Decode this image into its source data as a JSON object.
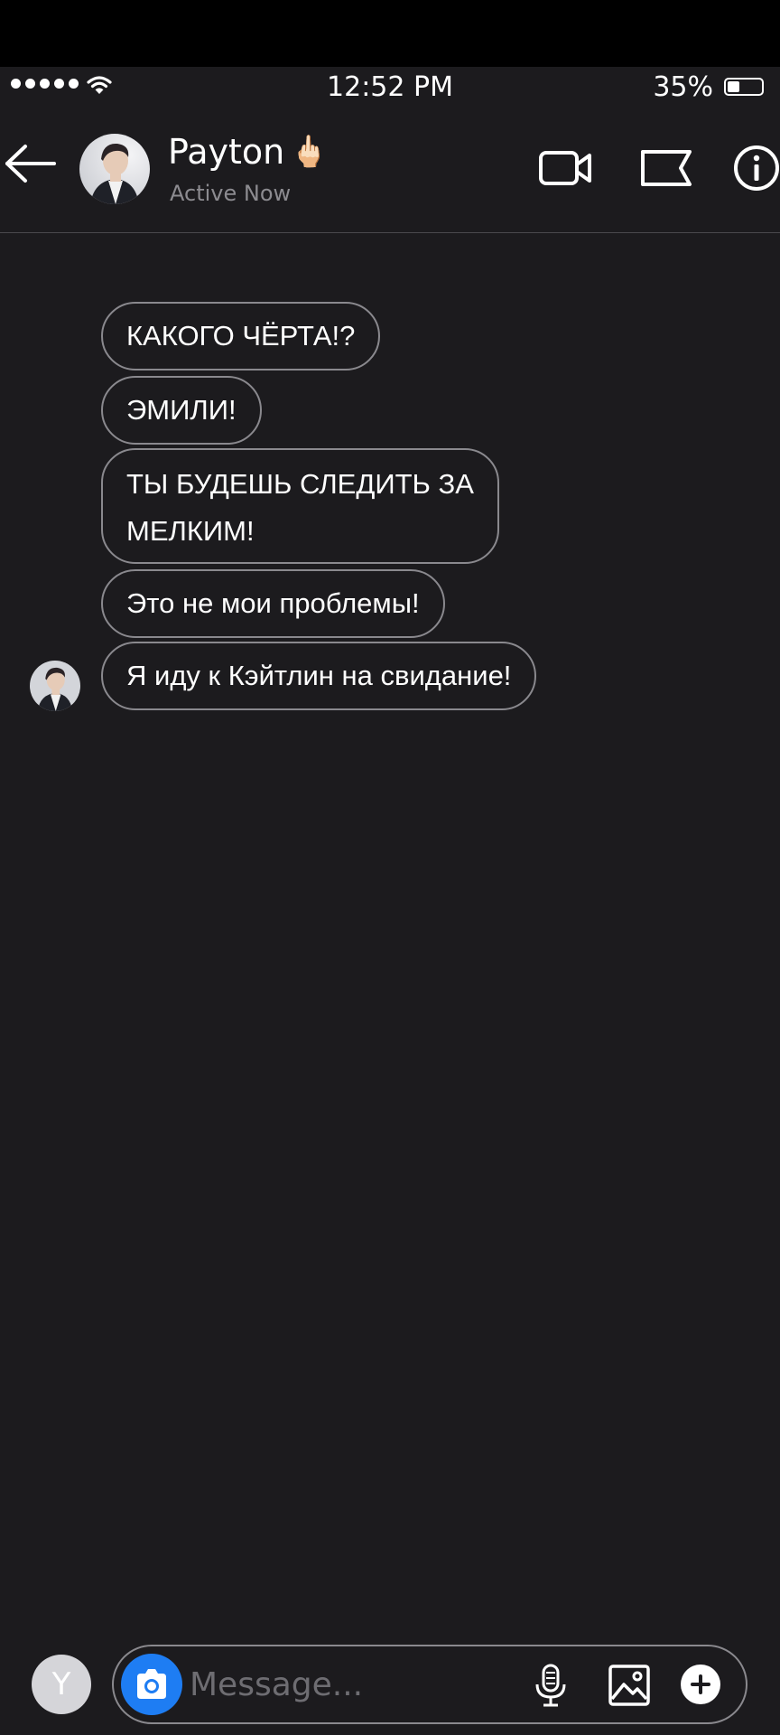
{
  "status_bar": {
    "time": "12:52 PM",
    "battery_text": "35%",
    "battery_level": 0.35
  },
  "header": {
    "contact_name": "Payton",
    "name_emoji": "🖕🏻",
    "status": "Active Now"
  },
  "messages": [
    "КАКОГО ЧЁРТА!?",
    "ЭМИЛИ!",
    "ТЫ БУДЕШЬ СЛЕДИТЬ ЗА\nМЕЛКИМ!",
    "Это не мои проблемы!",
    "Я иду к Кэйтлин на свидание!"
  ],
  "composer": {
    "avatar_initial": "Y",
    "placeholder": "Message..."
  },
  "colors": {
    "background": "#1c1b1e",
    "bubble_border": "#8a898e",
    "camera_button": "#1e7df3"
  },
  "icons": [
    "back-arrow-icon",
    "video-camera-icon",
    "flag-icon",
    "info-icon",
    "camera-icon",
    "microphone-icon",
    "gallery-icon",
    "plus-icon",
    "wifi-icon",
    "battery-icon"
  ]
}
